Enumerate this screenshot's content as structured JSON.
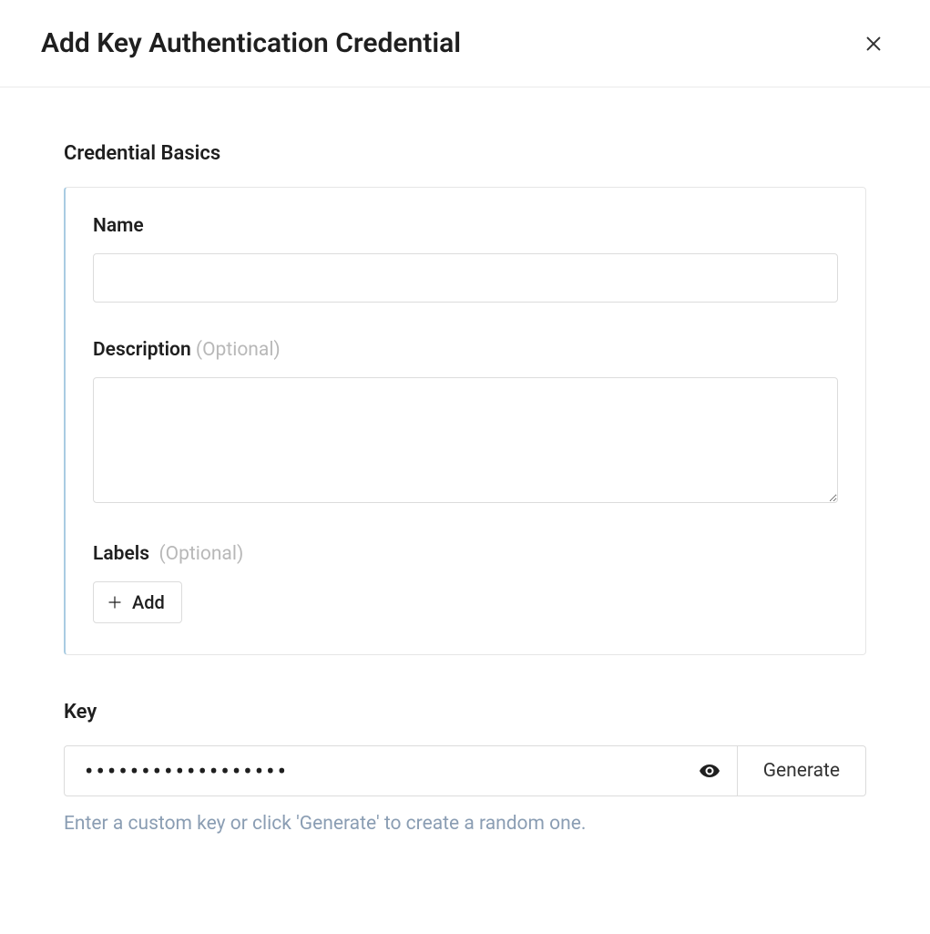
{
  "dialog": {
    "title": "Add Key Authentication Credential"
  },
  "sections": {
    "basics": {
      "heading": "Credential Basics",
      "name": {
        "label": "Name",
        "value": "",
        "placeholder": ""
      },
      "description": {
        "label": "Description",
        "optional_suffix": "(Optional)",
        "value": "",
        "placeholder": ""
      },
      "labels": {
        "label": "Labels",
        "optional_suffix": "(Optional)",
        "add_button": "Add"
      }
    },
    "key": {
      "heading": "Key",
      "value": "••••••••••••••••••",
      "generate_button": "Generate",
      "help_text": "Enter a custom key or click 'Generate' to create a random one."
    }
  }
}
